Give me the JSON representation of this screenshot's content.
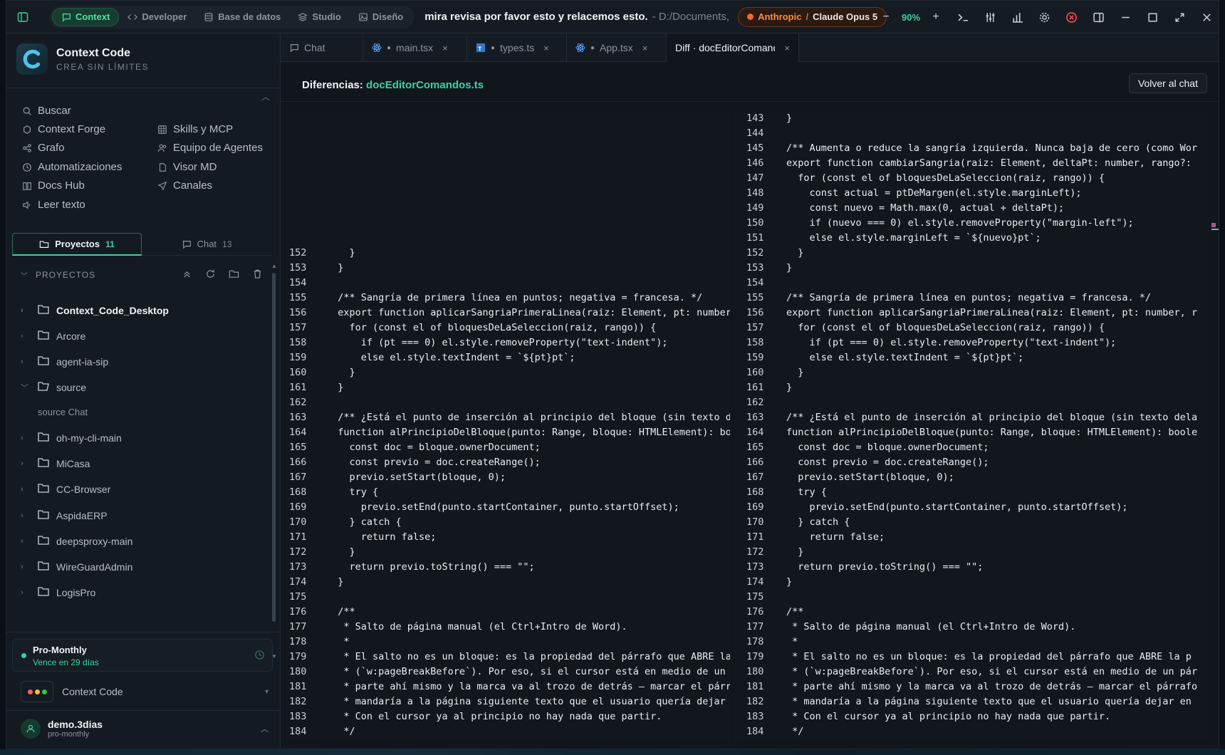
{
  "topbar": {
    "modes": [
      {
        "label": "Context",
        "active": true,
        "icon": "chat-icon"
      },
      {
        "label": "Developer",
        "active": false,
        "icon": "code-icon"
      },
      {
        "label": "Base de datos",
        "active": false,
        "icon": "database-icon"
      },
      {
        "label": "Studio",
        "active": false,
        "icon": "layers-icon"
      },
      {
        "label": "Diseño",
        "active": false,
        "icon": "image-icon"
      }
    ],
    "task": "mira revisa por favor esto y relacemos esto.",
    "path": "- D:/Documents,",
    "provider": "Anthropic",
    "separator": "/",
    "model": "Claude Opus 5",
    "zoom": "90%",
    "zoom_minus": "−",
    "zoom_plus": "+"
  },
  "sidebar": {
    "brand_name": "Context Code",
    "brand_tagline": "CREA SIN LÍMITES",
    "nav": [
      {
        "label": "Buscar",
        "icon": "search-icon"
      },
      {
        "label": "Context Forge",
        "icon": "forge-icon"
      },
      {
        "label": "Grafo",
        "icon": "graph-icon"
      },
      {
        "label": "Automatizaciones",
        "icon": "clock-icon"
      },
      {
        "label": "Docs Hub",
        "icon": "book-icon"
      },
      {
        "label": "Leer texto",
        "icon": "speaker-icon"
      },
      {
        "label": "Skills y MCP",
        "icon": "grid-icon"
      },
      {
        "label": "Equipo de Agentes",
        "icon": "users-icon"
      },
      {
        "label": "Visor MD",
        "icon": "file-icon"
      },
      {
        "label": "Canales",
        "icon": "send-icon"
      }
    ],
    "tabs": [
      {
        "label": "Proyectos",
        "count": "11",
        "active": true
      },
      {
        "label": "Chat",
        "count": "13",
        "active": false
      }
    ],
    "projects_header": "PROYECTOS",
    "projects": [
      {
        "name": "Context_Code_Desktop",
        "bold": true,
        "open": false
      },
      {
        "name": "Arcore",
        "bold": false,
        "open": false
      },
      {
        "name": "agent-ia-sip",
        "bold": false,
        "open": false
      },
      {
        "name": "source",
        "bold": false,
        "open": true
      },
      {
        "name": "source Chat",
        "bold": false,
        "sub": true
      },
      {
        "name": "oh-my-cli-main",
        "bold": false,
        "open": false
      },
      {
        "name": "MiCasa",
        "bold": false,
        "open": false
      },
      {
        "name": "CC-Browser",
        "bold": false,
        "open": false
      },
      {
        "name": "AspidaERP",
        "bold": false,
        "open": false
      },
      {
        "name": "deepsproxy-main",
        "bold": false,
        "open": false
      },
      {
        "name": "WireGuardAdmin",
        "bold": false,
        "open": false
      },
      {
        "name": "LogisPro",
        "bold": false,
        "open": false
      }
    ],
    "plan": {
      "name": "Pro-Monthly",
      "expiry": "Vence en 29 días"
    },
    "workspace": {
      "name": "Context Code",
      "dots": [
        "#ff5f57",
        "#ffbd2e",
        "#28c840"
      ]
    },
    "user": {
      "name": "demo.3dias",
      "plan": "pro-monthly"
    }
  },
  "editor": {
    "tabs": [
      {
        "label": "Chat",
        "icon": "chat-icon",
        "modified": false,
        "closable": false,
        "active": false
      },
      {
        "label": "main.tsx",
        "icon": "react-icon",
        "modified": true,
        "closable": true,
        "active": false
      },
      {
        "label": "types.ts",
        "icon": "ts-icon",
        "modified": true,
        "closable": true,
        "active": false
      },
      {
        "label": "App.tsx",
        "icon": "react-icon",
        "modified": true,
        "closable": true,
        "active": false
      },
      {
        "label": "Diff · docEditorComandos.ts",
        "icon": "",
        "modified": false,
        "closable": true,
        "active": true
      }
    ],
    "close_glyph": "×",
    "diff_label": "Diferencias:",
    "diff_file": "docEditorComandos.ts",
    "back_button": "Volver al chat"
  },
  "diff": {
    "left": [
      {
        "n": "152",
        "t": "    }"
      },
      {
        "n": "153",
        "t": "  }"
      },
      {
        "n": "154",
        "t": ""
      },
      {
        "n": "155",
        "t": "  /** Sangría de primera línea en puntos; negativa = francesa. */"
      },
      {
        "n": "156",
        "t": "  export function aplicarSangriaPrimeraLinea(raiz: Element, pt: number"
      },
      {
        "n": "157",
        "t": "    for (const el of bloquesDeLaSeleccion(raiz, rango)) {"
      },
      {
        "n": "158",
        "t": "      if (pt === 0) el.style.removeProperty(\"text-indent\");"
      },
      {
        "n": "159",
        "t": "      else el.style.textIndent = `${pt}pt`;"
      },
      {
        "n": "160",
        "t": "    }"
      },
      {
        "n": "161",
        "t": "  }"
      },
      {
        "n": "162",
        "t": ""
      },
      {
        "n": "163",
        "t": "  /** ¿Está el punto de inserción al principio del bloque (sin texto d"
      },
      {
        "n": "164",
        "t": "  function alPrincipioDelBloque(punto: Range, bloque: HTMLElement): bo"
      },
      {
        "n": "165",
        "t": "    const doc = bloque.ownerDocument;"
      },
      {
        "n": "166",
        "t": "    const previo = doc.createRange();"
      },
      {
        "n": "167",
        "t": "    previo.setStart(bloque, 0);"
      },
      {
        "n": "168",
        "t": "    try {"
      },
      {
        "n": "169",
        "t": "      previo.setEnd(punto.startContainer, punto.startOffset);"
      },
      {
        "n": "170",
        "t": "    } catch {"
      },
      {
        "n": "171",
        "t": "      return false;"
      },
      {
        "n": "172",
        "t": "    }"
      },
      {
        "n": "173",
        "t": "    return previo.toString() === \"\";"
      },
      {
        "n": "174",
        "t": "  }"
      },
      {
        "n": "175",
        "t": ""
      },
      {
        "n": "176",
        "t": "  /**"
      },
      {
        "n": "177",
        "t": "   * Salto de página manual (el Ctrl+Intro de Word)."
      },
      {
        "n": "178",
        "t": "   *"
      },
      {
        "n": "179",
        "t": "   * El salto no es un bloque: es la propiedad del párrafo que ABRE la"
      },
      {
        "n": "180",
        "t": "   * (`w:pageBreakBefore`). Por eso, si el cursor está en medio de un"
      },
      {
        "n": "181",
        "t": "   * parte ahí mismo y la marca va al trozo de detrás — marcar el párr"
      },
      {
        "n": "182",
        "t": "   * mandaría a la página siguiente texto que el usuario quería dejar"
      },
      {
        "n": "183",
        "t": "   * Con el cursor ya al principio no hay nada que partir."
      },
      {
        "n": "184",
        "t": "   */"
      }
    ],
    "right": [
      {
        "n": "143",
        "t": "}"
      },
      {
        "n": "144",
        "t": ""
      },
      {
        "n": "145",
        "t": "/** Aumenta o reduce la sangría izquierda. Nunca baja de cero (como Wor"
      },
      {
        "n": "146",
        "t": "export function cambiarSangria(raiz: Element, deltaPt: number, rango?:"
      },
      {
        "n": "147",
        "t": "  for (const el of bloquesDeLaSeleccion(raiz, rango)) {"
      },
      {
        "n": "148",
        "t": "    const actual = ptDeMargen(el.style.marginLeft);"
      },
      {
        "n": "149",
        "t": "    const nuevo = Math.max(0, actual + deltaPt);"
      },
      {
        "n": "150",
        "t": "    if (nuevo === 0) el.style.removeProperty(\"margin-left\");"
      },
      {
        "n": "151",
        "t": "    else el.style.marginLeft = `${nuevo}pt`;"
      },
      {
        "n": "152",
        "t": "  }"
      },
      {
        "n": "153",
        "t": "}"
      },
      {
        "n": "154",
        "t": ""
      },
      {
        "n": "155",
        "t": "/** Sangría de primera línea en puntos; negativa = francesa. */"
      },
      {
        "n": "156",
        "t": "export function aplicarSangriaPrimeraLinea(raiz: Element, pt: number, r"
      },
      {
        "n": "157",
        "t": "  for (const el of bloquesDeLaSeleccion(raiz, rango)) {"
      },
      {
        "n": "158",
        "t": "    if (pt === 0) el.style.removeProperty(\"text-indent\");"
      },
      {
        "n": "159",
        "t": "    else el.style.textIndent = `${pt}pt`;"
      },
      {
        "n": "160",
        "t": "  }"
      },
      {
        "n": "161",
        "t": "}"
      },
      {
        "n": "162",
        "t": ""
      },
      {
        "n": "163",
        "t": "/** ¿Está el punto de inserción al principio del bloque (sin texto dela"
      },
      {
        "n": "164",
        "t": "function alPrincipioDelBloque(punto: Range, bloque: HTMLElement): boole"
      },
      {
        "n": "165",
        "t": "  const doc = bloque.ownerDocument;"
      },
      {
        "n": "166",
        "t": "  const previo = doc.createRange();"
      },
      {
        "n": "167",
        "t": "  previo.setStart(bloque, 0);"
      },
      {
        "n": "168",
        "t": "  try {"
      },
      {
        "n": "169",
        "t": "    previo.setEnd(punto.startContainer, punto.startOffset);"
      },
      {
        "n": "170",
        "t": "  } catch {"
      },
      {
        "n": "171",
        "t": "    return false;"
      },
      {
        "n": "172",
        "t": "  }"
      },
      {
        "n": "173",
        "t": "  return previo.toString() === \"\";"
      },
      {
        "n": "174",
        "t": "}"
      },
      {
        "n": "175",
        "t": ""
      },
      {
        "n": "176",
        "t": "/**"
      },
      {
        "n": "177",
        "t": " * Salto de página manual (el Ctrl+Intro de Word)."
      },
      {
        "n": "178",
        "t": " *"
      },
      {
        "n": "179",
        "t": " * El salto no es un bloque: es la propiedad del párrafo que ABRE la p"
      },
      {
        "n": "180",
        "t": " * (`w:pageBreakBefore`). Por eso, si el cursor está en medio de un pár"
      },
      {
        "n": "181",
        "t": " * parte ahí mismo y la marca va al trozo de detrás — marcar el párrafo"
      },
      {
        "n": "182",
        "t": " * mandaría a la página siguiente texto que el usuario quería dejar en"
      },
      {
        "n": "183",
        "t": " * Con el cursor ya al principio no hay nada que partir."
      },
      {
        "n": "184",
        "t": " */"
      }
    ]
  }
}
